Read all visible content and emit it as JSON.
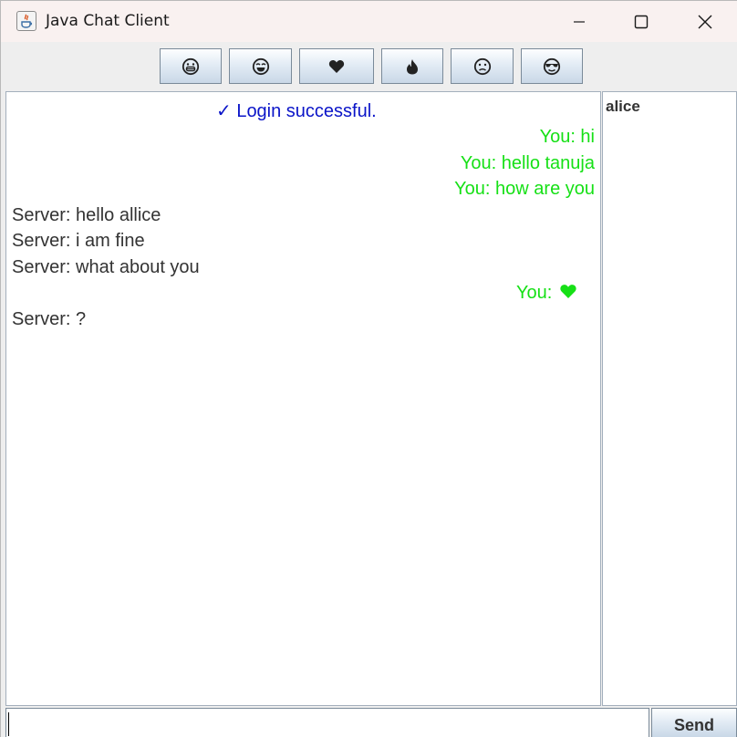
{
  "window": {
    "title": "Java Chat Client"
  },
  "toolbar": {
    "buttons": [
      {
        "icon": "grinning-face-icon"
      },
      {
        "icon": "tears-of-joy-face-icon"
      },
      {
        "icon": "heart-icon"
      },
      {
        "icon": "fire-icon"
      },
      {
        "icon": "confused-face-icon"
      },
      {
        "icon": "sunglasses-face-icon"
      }
    ]
  },
  "chat": {
    "messages": [
      {
        "type": "system",
        "text": "✓ Login successful."
      },
      {
        "type": "sent",
        "text": "You: hi"
      },
      {
        "type": "sent",
        "text": "You: hello tanuja"
      },
      {
        "type": "sent",
        "text": "You: how are you"
      },
      {
        "type": "recv",
        "text": "Server: hello allice"
      },
      {
        "type": "recv",
        "text": "Server: i am fine"
      },
      {
        "type": "recv",
        "text": "Server: what about you"
      },
      {
        "type": "sent",
        "text": "You:",
        "icon": "heart-icon"
      },
      {
        "type": "recv",
        "text": "Server: ?"
      }
    ]
  },
  "users": {
    "items": [
      "alice"
    ]
  },
  "input": {
    "value": ""
  },
  "send": {
    "label": "Send"
  },
  "colors": {
    "system": "#0a14c8",
    "sent": "#16e016",
    "received": "#333333"
  }
}
